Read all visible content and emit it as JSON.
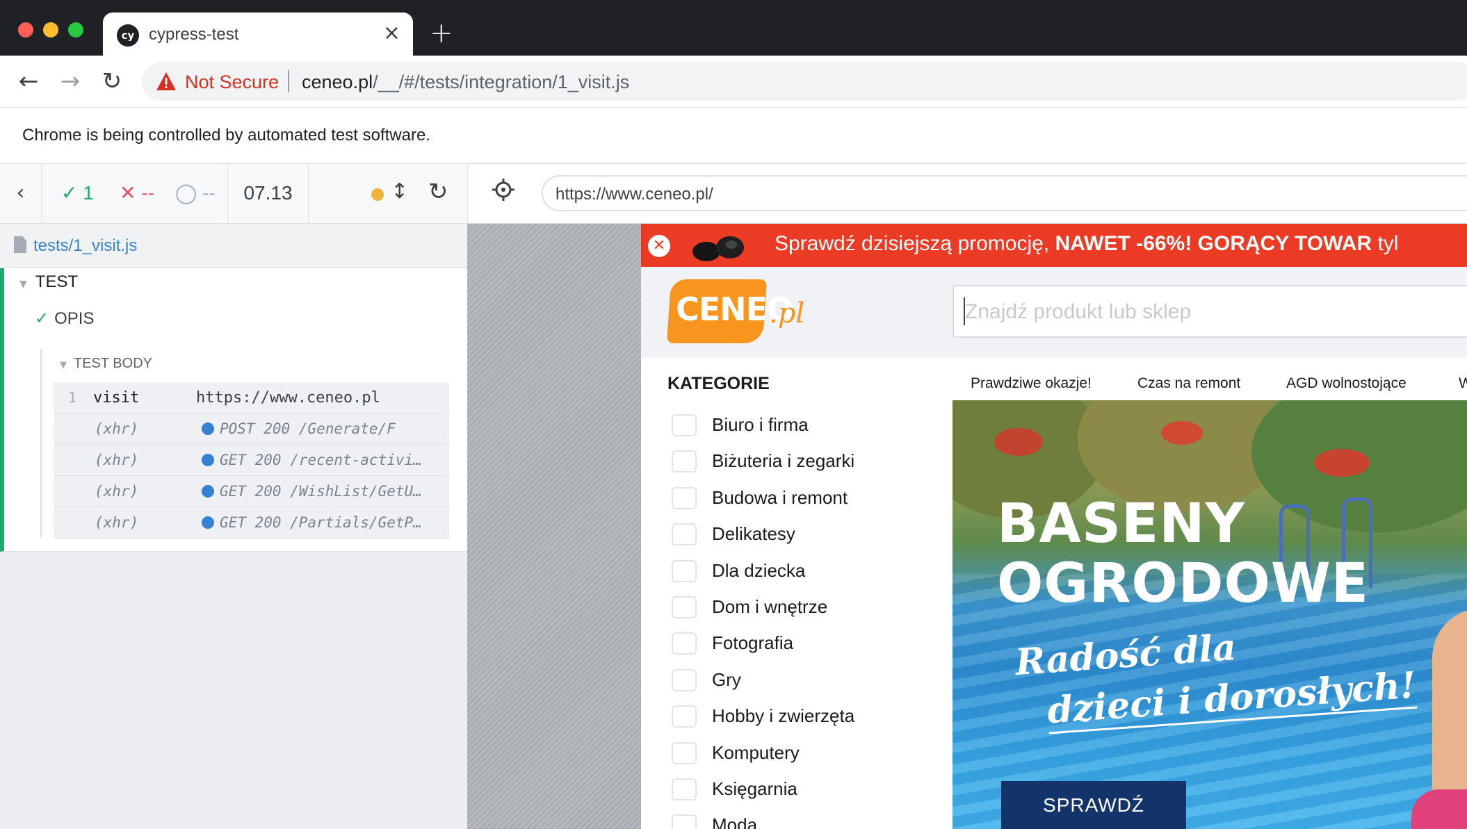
{
  "browser": {
    "tab_title": "cypress-test",
    "tab_close": "×",
    "new_tab": "+",
    "security_label": "Not Secure",
    "url_host": "ceneo.pl",
    "url_path": "/__/#/tests/integration/1_visit.js",
    "infobar": "Chrome is being controlled by automated test software."
  },
  "reporter": {
    "stats": {
      "passed": "1",
      "failed": "--",
      "pending": "--"
    },
    "duration": "07.13",
    "spec_file": "tests/1_visit.js",
    "suite": "TEST",
    "test": "OPIS",
    "hook": "TEST BODY",
    "commands": [
      {
        "num": "1",
        "name": "visit",
        "message": "https://www.ceneo.pl"
      },
      {
        "num": "",
        "name": "(xhr)",
        "message": "POST 200 /Generate/F"
      },
      {
        "num": "",
        "name": "(xhr)",
        "message": "GET 200 /recent-activi…"
      },
      {
        "num": "",
        "name": "(xhr)",
        "message": "GET 200 /WishList/GetU…"
      },
      {
        "num": "",
        "name": "(xhr)",
        "message": "GET 200 /Partials/GetP…"
      }
    ]
  },
  "aut": {
    "url": "https://www.ceneo.pl/"
  },
  "site": {
    "promo_text": "Sprawdź dzisiejszą promocję, ",
    "promo_bold": "NAWET -66%!  GORĄCY TOWAR",
    "promo_tail": " tyl",
    "logo_main": "CENEO",
    "logo_pl": ".pl",
    "search_placeholder": "Znajdź produkt lub sklep",
    "categories_heading": "KATEGORIE",
    "categories": [
      "Biuro i firma",
      "Biżuteria i zegarki",
      "Budowa i remont",
      "Delikatesy",
      "Dla dziecka",
      "Dom i wnętrze",
      "Fotografia",
      "Gry",
      "Hobby i zwierzęta",
      "Komputery",
      "Księgarnia",
      "Moda"
    ],
    "top_links": [
      "Prawdziwe okazje!",
      "Czas na remont",
      "AGD wolnostojące",
      "We"
    ],
    "banner": {
      "line1": "BASENY",
      "line2": "OGRODOWE",
      "sub1": "Radość dla",
      "sub2": "dzieci i dorosłych!",
      "button": "SPRAWDŹ"
    }
  },
  "colors": {
    "cypress_pass": "#1fa971",
    "cypress_fail": "#e94f5f",
    "cypress_link": "#3582d3",
    "ceneo_orange": "#f7951e",
    "promo_red": "#ec3b24",
    "banner_button": "#13336b"
  }
}
